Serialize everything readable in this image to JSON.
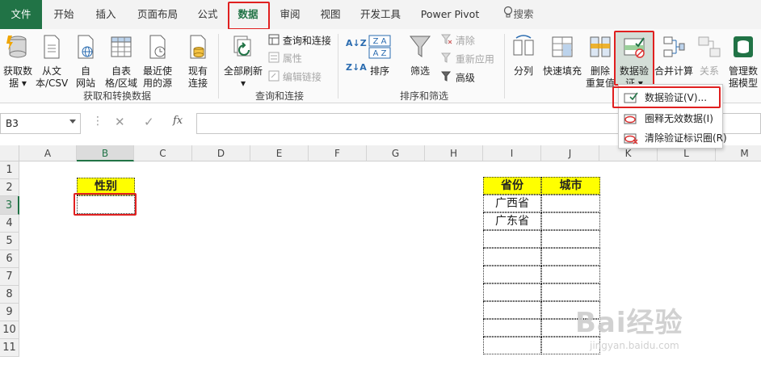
{
  "tabs": {
    "file": "文件",
    "home": "开始",
    "insert": "插入",
    "page_layout": "页面布局",
    "formulas": "公式",
    "data": "数据",
    "review": "审阅",
    "view": "视图",
    "developer": "开发工具",
    "power_pivot": "Power Pivot",
    "search": "搜索"
  },
  "ribbon": {
    "get_data": [
      "获取数",
      "据 ▾"
    ],
    "from_text": [
      "从文",
      "本/CSV"
    ],
    "from_web": [
      "自",
      "网站"
    ],
    "from_table": [
      "自表",
      "格/区域"
    ],
    "recent_sources": [
      "最近使",
      "用的源"
    ],
    "existing": [
      "现有",
      "连接"
    ],
    "group_get": "获取和转换数据",
    "refresh_all": [
      "全部刷新",
      "▾"
    ],
    "queries_connections": "查询和连接",
    "properties": "属性",
    "edit_links": "编辑链接",
    "group_queries": "查询和连接",
    "sort_az": "A↓Z",
    "sort_za": "Z↓A",
    "sort": "排序",
    "filter": "筛选",
    "clear": "清除",
    "reapply": "重新应用",
    "advanced": "高级",
    "group_sort": "排序和筛选",
    "text_to_columns": "分列",
    "flash_fill": "快速填充",
    "remove_duplicates": [
      "删除",
      "重复值"
    ],
    "data_validation": [
      "数据验",
      "证 ▾"
    ],
    "consolidate": "合并计算",
    "relationships": "关系",
    "manage_model": [
      "管理数",
      "据模型"
    ]
  },
  "formula_bar": {
    "name_box": "B3",
    "cancel": "✕",
    "enter": "✓",
    "fx": "fx",
    "formula": ""
  },
  "columns": [
    "A",
    "B",
    "C",
    "D",
    "E",
    "F",
    "G",
    "H",
    "I",
    "J",
    "K",
    "L",
    "M"
  ],
  "rows": [
    "1",
    "2",
    "3",
    "4",
    "5",
    "6",
    "7",
    "8",
    "9",
    "10",
    "11"
  ],
  "sheet": {
    "b2": "性别",
    "i2": "省份",
    "j2": "城市",
    "i3": "广西省",
    "i4": "广东省"
  },
  "dropdown": {
    "items": [
      "数据验证(V)...",
      "圈释无效数据(I)",
      "清除验证标识圈(R)"
    ]
  },
  "watermark": {
    "brand": "Bai经验",
    "url": "jingyan.baidu.com"
  },
  "colors": {
    "accent": "#217346",
    "highlight": "#e02020",
    "header_fill": "#ffff00"
  }
}
